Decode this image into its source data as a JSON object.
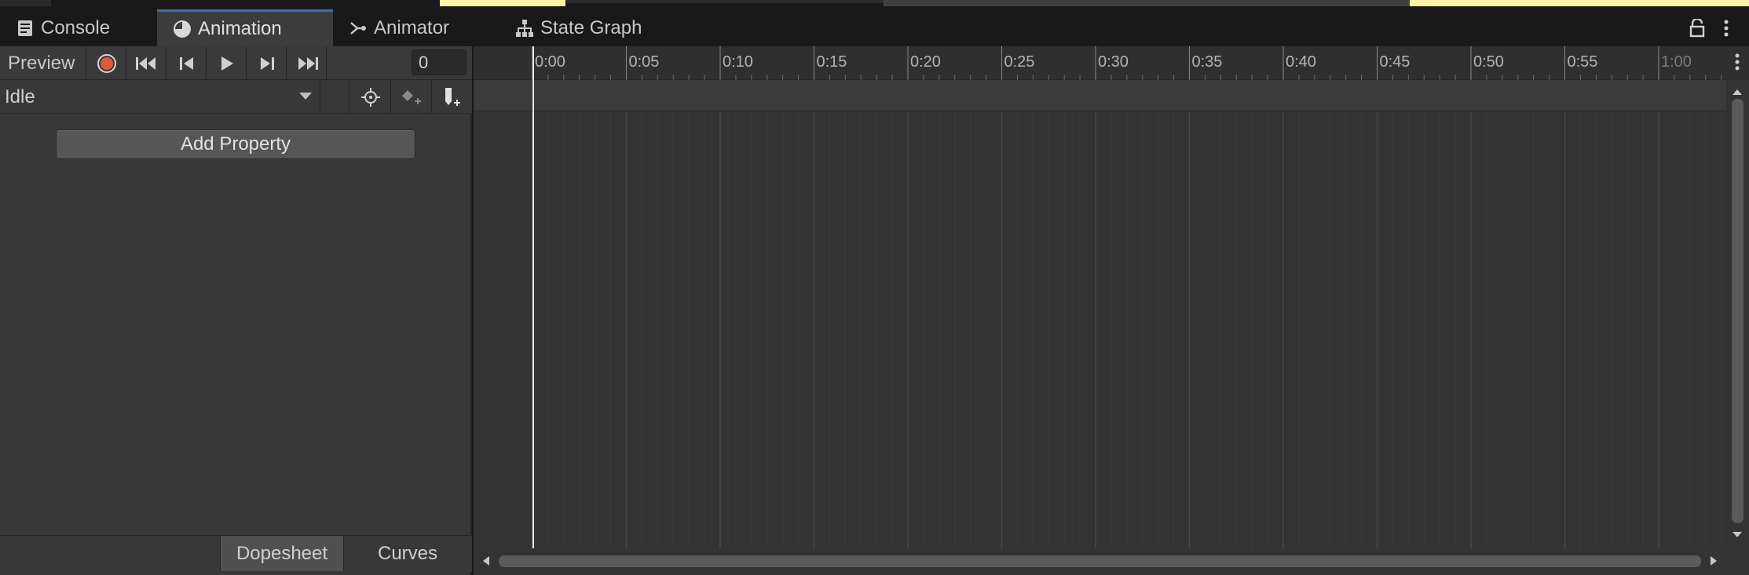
{
  "tabs": {
    "console": "Console",
    "animation": "Animation",
    "animator": "Animator",
    "state_graph": "State Graph"
  },
  "controls": {
    "preview_label": "Preview",
    "frame_value": "0"
  },
  "clip": {
    "selected": "Idle"
  },
  "left_panel": {
    "add_property_label": "Add Property"
  },
  "bottom_tabs": {
    "dopesheet": "Dopesheet",
    "curves": "Curves"
  },
  "timeline": {
    "ticks": [
      "0:00",
      "0:05",
      "0:10",
      "0:15",
      "0:20",
      "0:25",
      "0:30",
      "0:35",
      "0:40",
      "0:45",
      "0:50",
      "0:55",
      "1:00"
    ],
    "playhead_frame": 0
  },
  "colors": {
    "record": "#e05a3a",
    "active_tab_accent": "#3a72b0",
    "top_highlight": "#fef5a8"
  },
  "icons": {
    "console": "console-icon",
    "animation": "clock-icon",
    "animator": "animator-icon",
    "state_graph": "hierarchy-icon"
  }
}
